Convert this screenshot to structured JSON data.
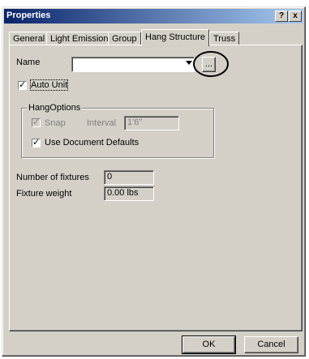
{
  "window": {
    "title": "Properties",
    "help_button": "?",
    "close_button": "x"
  },
  "tabs": [
    {
      "label": "General"
    },
    {
      "label": "Light Emission"
    },
    {
      "label": "Group"
    },
    {
      "label": "Hang Structure"
    },
    {
      "label": "Truss"
    }
  ],
  "active_tab": "Hang Structure",
  "name_field": {
    "label": "Name",
    "value": "",
    "browse_label": "..."
  },
  "auto_unit": {
    "label": "Auto Unit",
    "checked": true
  },
  "hang_options": {
    "title": "HangOptions",
    "snap_label": "Snap",
    "snap_checked": true,
    "interval_label": "Interval",
    "interval_value": "1'6\"",
    "use_defaults_label": "Use Document Defaults",
    "use_defaults_checked": true
  },
  "fixtures": {
    "count_label": "Number of fixtures",
    "count_value": "0",
    "weight_label": "Fixture weight",
    "weight_value": "0.00 lbs"
  },
  "buttons": {
    "ok": "OK",
    "cancel": "Cancel"
  },
  "colors": {
    "title_gradient_start": "#0a246a",
    "title_gradient_end": "#a6caf0",
    "dialog_face": "#d4d0c8"
  }
}
